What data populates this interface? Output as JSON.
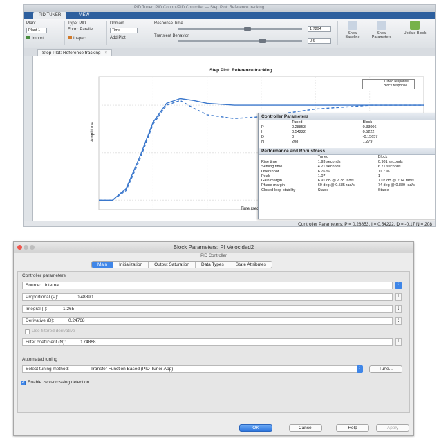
{
  "tuner": {
    "window_title": "PID Tuner: PID Control/PID Controller — Step Plot: Reference tracking",
    "tabs": [
      "PID TUNER",
      "VIEW"
    ],
    "plant_label": "Plant",
    "plant_value": "Plant 1",
    "import_label": "Import",
    "inspect_label": "Inspect",
    "type_label": "Type: PID",
    "form_label": "Form: Parallel",
    "domain_label": "Domain",
    "domain_value": "Time",
    "add_plot_label": "Add Plot",
    "response_label": "Response Time",
    "robustness_label": "Transient Behavior",
    "response_value": "1.7294",
    "robust_value": "0.6",
    "show_baseline": "Show Baseline",
    "show_parameters": "Show Parameters",
    "update_block": "Update Block",
    "doc_tab": "Step Plot: Reference tracking",
    "plot_title": "Step Plot: Reference tracking",
    "ylabel": "Amplitude",
    "xlabel": "Time (seconds)",
    "legend": [
      "Tuned response",
      "Block response"
    ],
    "status": "Controller Parameters: P = 0.28853, I = 0.54222, D = -0.17 N = 208",
    "panel": {
      "params_title": "Controller Parameters",
      "params_head": [
        "",
        "Tuned",
        "Block"
      ],
      "params_rows": [
        [
          "P",
          "0.28853",
          "0.33006"
        ],
        [
          "I",
          "0.54222",
          "0.5222"
        ],
        [
          "D",
          "0",
          "-0.15657"
        ],
        [
          "N",
          "208",
          "1.279"
        ]
      ],
      "perf_title": "Performance and Robustness",
      "perf_head": [
        "",
        "Tuned",
        "Block"
      ],
      "perf_rows": [
        [
          "Rise time",
          "1.93 seconds",
          "0.981 seconds"
        ],
        [
          "Settling time",
          "4.21 seconds",
          "6.71 seconds"
        ],
        [
          "Overshoot",
          "6.76 %",
          "11.7 %"
        ],
        [
          "Peak",
          "1.07",
          "1"
        ],
        [
          "Gain margin",
          "6.91 dB @ 2.38 rad/s",
          "7.07 dB @ 2.14 rad/s"
        ],
        [
          "Phase margin",
          "60 deg @ 0.585 rad/s",
          "74 deg @ 0.889 rad/s"
        ],
        [
          "Closed-loop stability",
          "Stable",
          "Stable"
        ]
      ]
    }
  },
  "chart_data": {
    "type": "line",
    "title": "Step Plot: Reference tracking",
    "xlabel": "Time (seconds)",
    "ylabel": "Amplitude",
    "x": [
      0,
      0.5,
      1,
      1.5,
      2,
      2.5,
      3,
      3.5,
      4,
      5,
      6,
      7,
      8,
      9,
      10,
      11,
      12
    ],
    "series": [
      {
        "name": "Tuned response",
        "style": "solid",
        "values": [
          0,
          0,
          0.12,
          0.45,
          0.82,
          1.02,
          1.07,
          1.05,
          1.02,
          1.0,
          1.0,
          1.0,
          1.0,
          1.0,
          1.0,
          1.0,
          1.0
        ]
      },
      {
        "name": "Block response",
        "style": "dashed",
        "values": [
          0,
          0,
          0.1,
          0.42,
          0.8,
          1.0,
          1.05,
          0.97,
          0.9,
          0.86,
          0.88,
          0.92,
          0.96,
          0.98,
          1.0,
          1.0,
          1.0
        ]
      }
    ],
    "ylim": [
      -0.1,
      1.3
    ],
    "xlim": [
      0,
      12
    ],
    "grid": true,
    "legend_position": "top-right",
    "colors": {
      "series": "#3a77cc"
    }
  },
  "dialog": {
    "title": "Block Parameters: PI Velocidad2",
    "subtitle": "PID Controller",
    "tabs": [
      "Main",
      "Initialization",
      "Output Saturation",
      "Data Types",
      "State Attributes"
    ],
    "section_controller": "Controller parameters",
    "source_label": "Source:",
    "source_value": "internal",
    "p_label": "Proportional (P):",
    "p_value": "0.48890",
    "i_label": "Integral (I):",
    "i_value": "1.265",
    "d_label": "Derivative (D):",
    "d_value": "0.24768",
    "filter_check_label": "Use filtered derivative",
    "n_label": "Filter coefficient (N):",
    "n_value": "0.74868",
    "section_tuning": "Automated tuning",
    "tuning_label": "Select tuning method:",
    "tuning_value": "Transfer Function Based (PID Tuner App)",
    "tune_button": "Tune...",
    "zero_cross_label": "Enable zero-crossing detection",
    "ok": "OK",
    "cancel": "Cancel",
    "help": "Help",
    "apply": "Apply"
  },
  "colors": {
    "accent": "#3f86e8",
    "ribbon": "#2d5f9e",
    "curve": "#3a77cc"
  }
}
